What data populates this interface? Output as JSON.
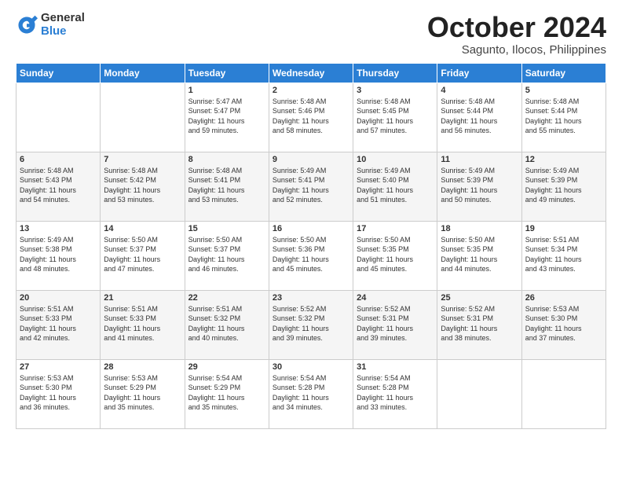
{
  "logo": {
    "general": "General",
    "blue": "Blue"
  },
  "header": {
    "month": "October 2024",
    "location": "Sagunto, Ilocos, Philippines"
  },
  "weekdays": [
    "Sunday",
    "Monday",
    "Tuesday",
    "Wednesday",
    "Thursday",
    "Friday",
    "Saturday"
  ],
  "weeks": [
    [
      {
        "day": "",
        "content": ""
      },
      {
        "day": "",
        "content": ""
      },
      {
        "day": "1",
        "content": "Sunrise: 5:47 AM\nSunset: 5:47 PM\nDaylight: 11 hours\nand 59 minutes."
      },
      {
        "day": "2",
        "content": "Sunrise: 5:48 AM\nSunset: 5:46 PM\nDaylight: 11 hours\nand 58 minutes."
      },
      {
        "day": "3",
        "content": "Sunrise: 5:48 AM\nSunset: 5:45 PM\nDaylight: 11 hours\nand 57 minutes."
      },
      {
        "day": "4",
        "content": "Sunrise: 5:48 AM\nSunset: 5:44 PM\nDaylight: 11 hours\nand 56 minutes."
      },
      {
        "day": "5",
        "content": "Sunrise: 5:48 AM\nSunset: 5:44 PM\nDaylight: 11 hours\nand 55 minutes."
      }
    ],
    [
      {
        "day": "6",
        "content": "Sunrise: 5:48 AM\nSunset: 5:43 PM\nDaylight: 11 hours\nand 54 minutes."
      },
      {
        "day": "7",
        "content": "Sunrise: 5:48 AM\nSunset: 5:42 PM\nDaylight: 11 hours\nand 53 minutes."
      },
      {
        "day": "8",
        "content": "Sunrise: 5:48 AM\nSunset: 5:41 PM\nDaylight: 11 hours\nand 53 minutes."
      },
      {
        "day": "9",
        "content": "Sunrise: 5:49 AM\nSunset: 5:41 PM\nDaylight: 11 hours\nand 52 minutes."
      },
      {
        "day": "10",
        "content": "Sunrise: 5:49 AM\nSunset: 5:40 PM\nDaylight: 11 hours\nand 51 minutes."
      },
      {
        "day": "11",
        "content": "Sunrise: 5:49 AM\nSunset: 5:39 PM\nDaylight: 11 hours\nand 50 minutes."
      },
      {
        "day": "12",
        "content": "Sunrise: 5:49 AM\nSunset: 5:39 PM\nDaylight: 11 hours\nand 49 minutes."
      }
    ],
    [
      {
        "day": "13",
        "content": "Sunrise: 5:49 AM\nSunset: 5:38 PM\nDaylight: 11 hours\nand 48 minutes."
      },
      {
        "day": "14",
        "content": "Sunrise: 5:50 AM\nSunset: 5:37 PM\nDaylight: 11 hours\nand 47 minutes."
      },
      {
        "day": "15",
        "content": "Sunrise: 5:50 AM\nSunset: 5:37 PM\nDaylight: 11 hours\nand 46 minutes."
      },
      {
        "day": "16",
        "content": "Sunrise: 5:50 AM\nSunset: 5:36 PM\nDaylight: 11 hours\nand 45 minutes."
      },
      {
        "day": "17",
        "content": "Sunrise: 5:50 AM\nSunset: 5:35 PM\nDaylight: 11 hours\nand 45 minutes."
      },
      {
        "day": "18",
        "content": "Sunrise: 5:50 AM\nSunset: 5:35 PM\nDaylight: 11 hours\nand 44 minutes."
      },
      {
        "day": "19",
        "content": "Sunrise: 5:51 AM\nSunset: 5:34 PM\nDaylight: 11 hours\nand 43 minutes."
      }
    ],
    [
      {
        "day": "20",
        "content": "Sunrise: 5:51 AM\nSunset: 5:33 PM\nDaylight: 11 hours\nand 42 minutes."
      },
      {
        "day": "21",
        "content": "Sunrise: 5:51 AM\nSunset: 5:33 PM\nDaylight: 11 hours\nand 41 minutes."
      },
      {
        "day": "22",
        "content": "Sunrise: 5:51 AM\nSunset: 5:32 PM\nDaylight: 11 hours\nand 40 minutes."
      },
      {
        "day": "23",
        "content": "Sunrise: 5:52 AM\nSunset: 5:32 PM\nDaylight: 11 hours\nand 39 minutes."
      },
      {
        "day": "24",
        "content": "Sunrise: 5:52 AM\nSunset: 5:31 PM\nDaylight: 11 hours\nand 39 minutes."
      },
      {
        "day": "25",
        "content": "Sunrise: 5:52 AM\nSunset: 5:31 PM\nDaylight: 11 hours\nand 38 minutes."
      },
      {
        "day": "26",
        "content": "Sunrise: 5:53 AM\nSunset: 5:30 PM\nDaylight: 11 hours\nand 37 minutes."
      }
    ],
    [
      {
        "day": "27",
        "content": "Sunrise: 5:53 AM\nSunset: 5:30 PM\nDaylight: 11 hours\nand 36 minutes."
      },
      {
        "day": "28",
        "content": "Sunrise: 5:53 AM\nSunset: 5:29 PM\nDaylight: 11 hours\nand 35 minutes."
      },
      {
        "day": "29",
        "content": "Sunrise: 5:54 AM\nSunset: 5:29 PM\nDaylight: 11 hours\nand 35 minutes."
      },
      {
        "day": "30",
        "content": "Sunrise: 5:54 AM\nSunset: 5:28 PM\nDaylight: 11 hours\nand 34 minutes."
      },
      {
        "day": "31",
        "content": "Sunrise: 5:54 AM\nSunset: 5:28 PM\nDaylight: 11 hours\nand 33 minutes."
      },
      {
        "day": "",
        "content": ""
      },
      {
        "day": "",
        "content": ""
      }
    ]
  ]
}
